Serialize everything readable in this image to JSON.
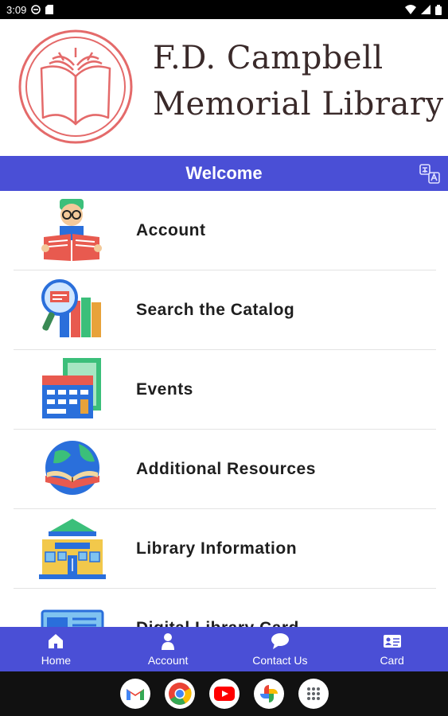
{
  "status_bar": {
    "time": "3:09"
  },
  "header": {
    "title_line1": "F.D. Campbell",
    "title_line2": "Memorial Library"
  },
  "welcome": {
    "title": "Welcome"
  },
  "menu": {
    "items": [
      {
        "label": "Account",
        "icon": "reader-icon"
      },
      {
        "label": "Search the Catalog",
        "icon": "magnifier-books-icon"
      },
      {
        "label": "Events",
        "icon": "calendar-icon"
      },
      {
        "label": "Additional Resources",
        "icon": "globe-book-icon"
      },
      {
        "label": "Library Information",
        "icon": "library-building-icon"
      },
      {
        "label": "Digital Library Card",
        "icon": "card-icon"
      }
    ]
  },
  "bottom_nav": {
    "items": [
      {
        "label": "Home",
        "icon": "home-icon"
      },
      {
        "label": "Account",
        "icon": "person-icon"
      },
      {
        "label": "Contact Us",
        "icon": "chat-bubble-icon"
      },
      {
        "label": "Card",
        "icon": "id-card-icon"
      }
    ]
  },
  "taskbar": {
    "apps": [
      "Gmail",
      "Chrome",
      "YouTube",
      "Photos",
      "App drawer"
    ]
  },
  "colors": {
    "accent": "#4a4fd6",
    "logo": "#e46a6a",
    "title_text": "#3a2a2a"
  }
}
